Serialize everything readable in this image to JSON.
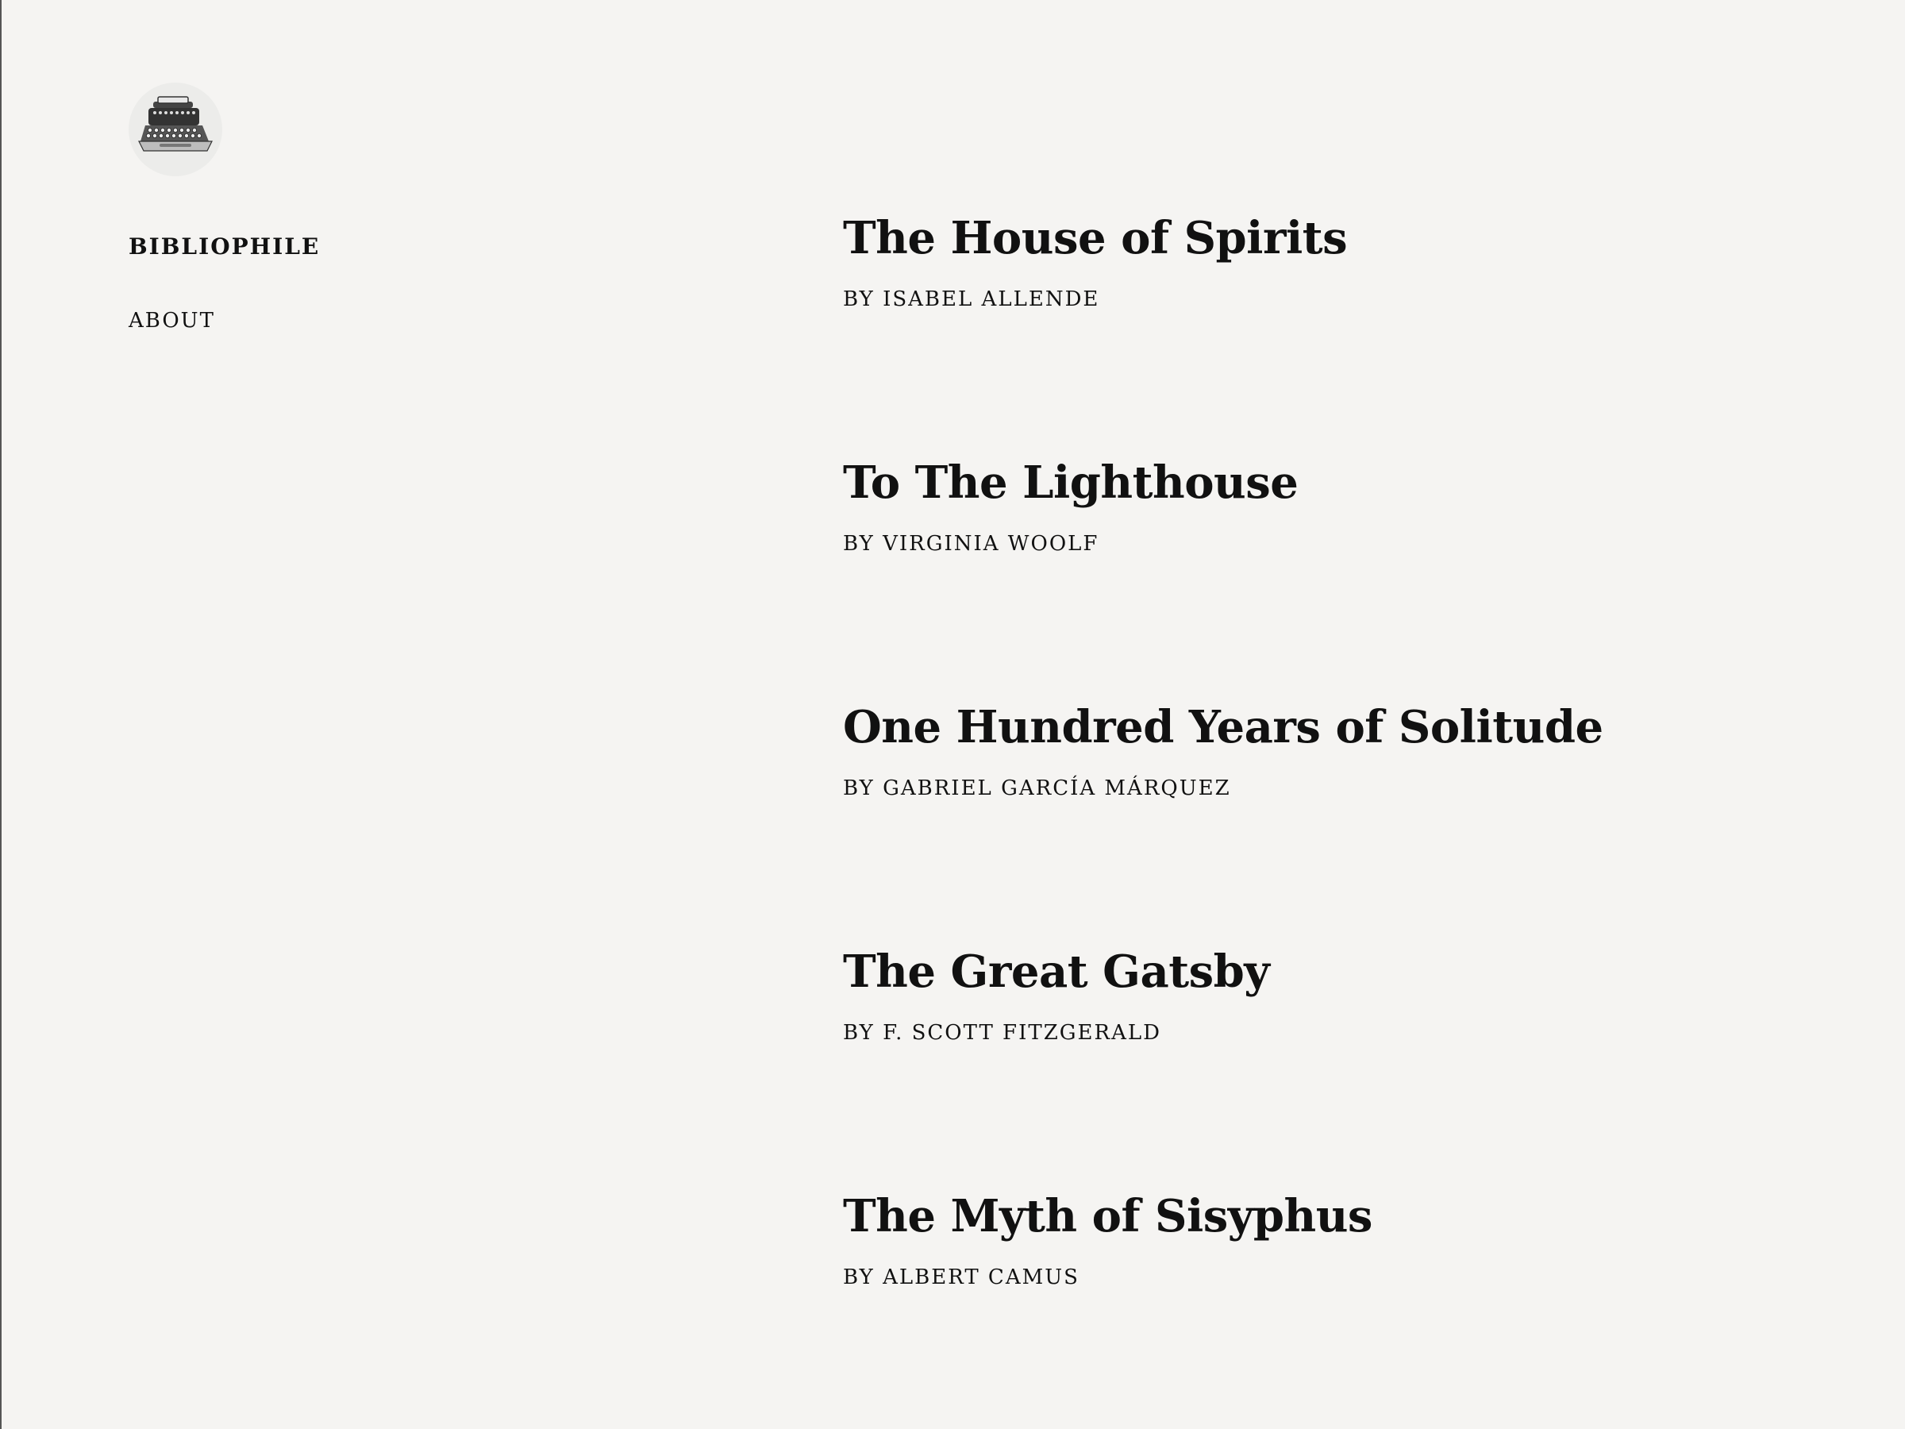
{
  "sidebar": {
    "avatar_icon": "typewriter-icon",
    "site_title": "BIBLIOPHILE",
    "nav": [
      {
        "label": "ABOUT"
      }
    ]
  },
  "posts": [
    {
      "title": "The House of Spirits",
      "author": "BY ISABEL ALLENDE"
    },
    {
      "title": "To The Lighthouse",
      "author": "BY VIRGINIA WOOLF"
    },
    {
      "title": "One Hundred Years of Solitude",
      "author": "BY GABRIEL GARCÍA MÁRQUEZ"
    },
    {
      "title": "The Great Gatsby",
      "author": "BY F. SCOTT FITZGERALD"
    },
    {
      "title": "The Myth of Sisyphus",
      "author": "BY ALBERT CAMUS"
    }
  ],
  "colors": {
    "background": "#f5f4f2",
    "text": "#111111",
    "avatar_bg": "#ececea"
  }
}
